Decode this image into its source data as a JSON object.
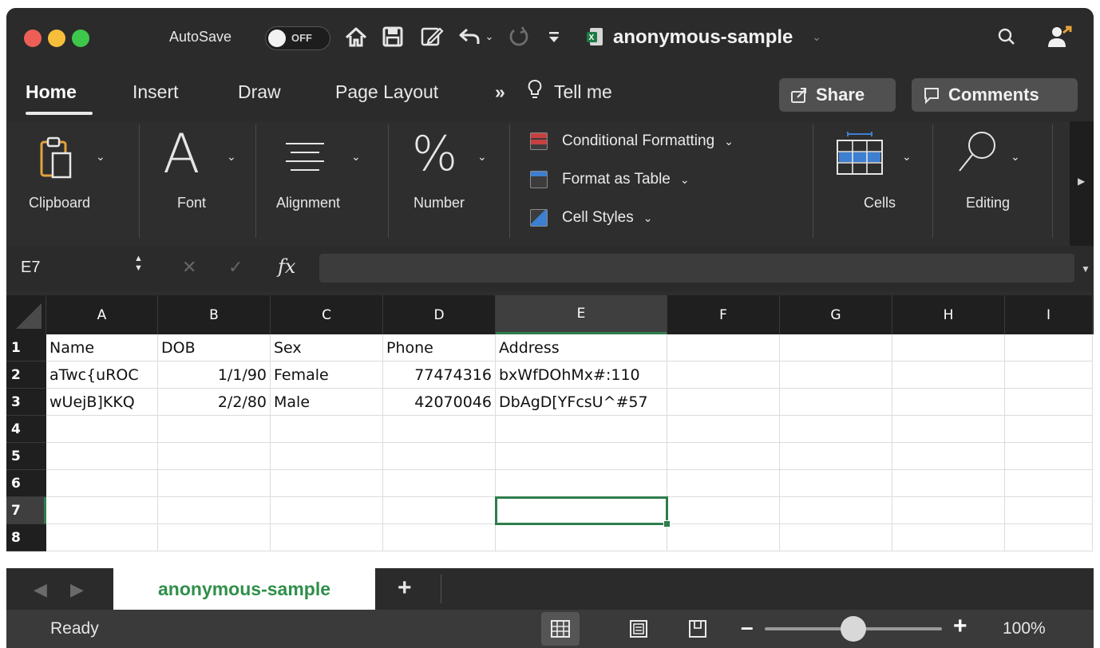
{
  "titlebar": {
    "autosave_label": "AutoSave",
    "autosave_state": "OFF",
    "file_name": "anonymous-sample",
    "traffic_light_colors": [
      "#ed5f56",
      "#f6be3b",
      "#3dc84b"
    ]
  },
  "tabs": [
    {
      "label": "Home",
      "active": true
    },
    {
      "label": "Insert",
      "active": false
    },
    {
      "label": "Draw",
      "active": false
    },
    {
      "label": "Page Layout",
      "active": false
    }
  ],
  "more_tabs_icon": "double-chevron-right",
  "tell_me": "Tell me",
  "share_label": "Share",
  "comments_label": "Comments",
  "ribbon": {
    "clipboard": "Clipboard",
    "font": "Font",
    "font_glyph": "A",
    "alignment": "Alignment",
    "number": "Number",
    "number_glyph": "%",
    "conditional_formatting": "Conditional Formatting",
    "format_as_table": "Format as Table",
    "cell_styles": "Cell Styles",
    "cells": "Cells",
    "editing": "Editing"
  },
  "formula_bar": {
    "name_box": "E7",
    "fx": "fx",
    "formula": ""
  },
  "grid": {
    "columns": [
      "A",
      "B",
      "C",
      "D",
      "E",
      "F",
      "G",
      "H",
      "I"
    ],
    "selected_column": "E",
    "rows": [
      "1",
      "2",
      "3",
      "4",
      "5",
      "6",
      "7",
      "8"
    ],
    "selected_row": "7",
    "cells": [
      [
        "Name",
        "DOB",
        "Sex",
        "Phone",
        "Address"
      ],
      [
        "aTwc{uROC",
        "1/1/90",
        "Female",
        "77474316",
        "bxWfDOhMx#:110"
      ],
      [
        "wUejB]KKQ",
        "2/2/80",
        "Male",
        "42070046",
        "DbAgD[YFcsU^#57"
      ]
    ]
  },
  "sheet_tab": "anonymous-sample",
  "add_sheet": "+",
  "status": {
    "text": "Ready",
    "zoom": "100%",
    "zoom_level": 1.0,
    "accent_color": "#2f7d4d"
  }
}
